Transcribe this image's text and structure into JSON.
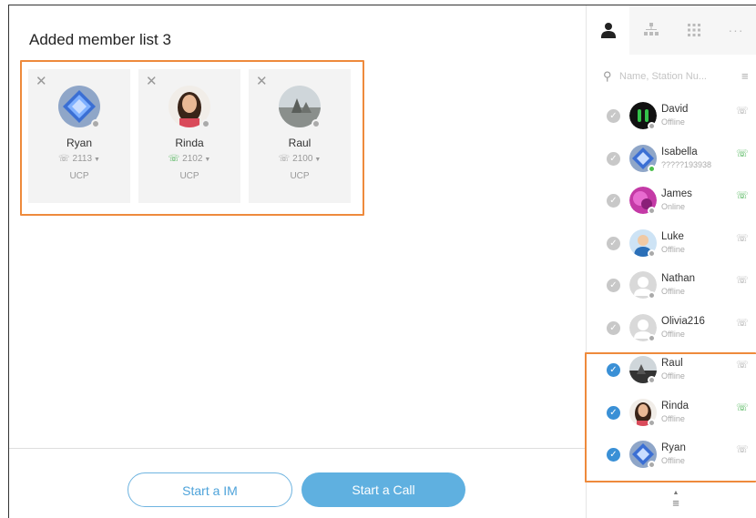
{
  "title": "Added member list 3",
  "members": [
    {
      "name": "Ryan",
      "ext": "2113",
      "type": "UCP",
      "phone_active": false
    },
    {
      "name": "Rinda",
      "ext": "2102",
      "type": "UCP",
      "phone_active": true
    },
    {
      "name": "Raul",
      "ext": "2100",
      "type": "UCP",
      "phone_active": false
    }
  ],
  "buttons": {
    "im": "Start a IM",
    "call": "Start a Call"
  },
  "tabs": [
    "person-icon",
    "org-chart-icon",
    "dialpad-icon",
    "more-icon"
  ],
  "search": {
    "placeholder": "Name, Station Nu..."
  },
  "contacts": [
    {
      "name": "David",
      "status": "Offline",
      "checked": false,
      "online": false,
      "phone_active": false
    },
    {
      "name": "Isabella",
      "status": "?????193938",
      "checked": false,
      "online": true,
      "phone_active": true
    },
    {
      "name": "James",
      "status": "Online",
      "checked": false,
      "online": false,
      "phone_active": true
    },
    {
      "name": "Luke",
      "status": "Offline",
      "checked": false,
      "online": false,
      "phone_active": false
    },
    {
      "name": "Nathan",
      "status": "Offline",
      "checked": false,
      "online": false,
      "phone_active": false
    },
    {
      "name": "Olivia216",
      "status": "Offline",
      "checked": false,
      "online": false,
      "phone_active": false
    },
    {
      "name": "Raul",
      "status": "Offline",
      "checked": true,
      "online": false,
      "phone_active": false
    },
    {
      "name": "Rinda",
      "status": "Offline",
      "checked": true,
      "online": false,
      "phone_active": true
    },
    {
      "name": "Ryan",
      "status": "Offline",
      "checked": true,
      "online": false,
      "phone_active": false
    }
  ],
  "colors": {
    "accent": "#5fb0e0",
    "highlight": "#ee8a3c",
    "online": "#4cbf4c",
    "checked": "#3a90d6"
  }
}
